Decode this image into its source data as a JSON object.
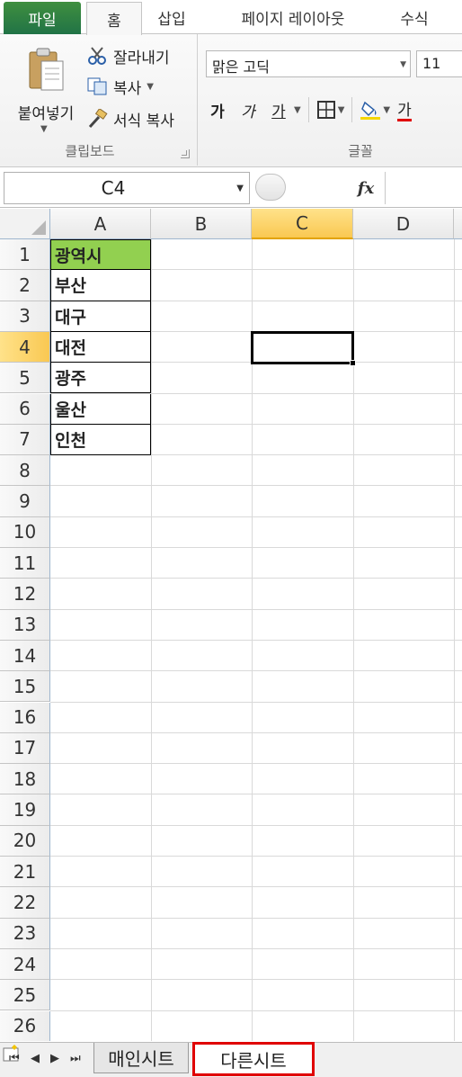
{
  "ribbon": {
    "tabs": [
      {
        "label": "파일"
      },
      {
        "label": "홈"
      },
      {
        "label": "삽입"
      },
      {
        "label": "페이지 레이아웃"
      },
      {
        "label": "수식"
      }
    ],
    "clipboard": {
      "paste_label": "붙여넣기",
      "cut_label": "잘라내기",
      "copy_label": "복사",
      "format_painter_label": "서식 복사",
      "group_label": "클립보드"
    },
    "font": {
      "name": "맑은 고딕",
      "size": "11",
      "bold_label": "가",
      "italic_label": "가",
      "underline_label": "가",
      "color_label": "가",
      "group_label": "글꼴"
    }
  },
  "formula_bar": {
    "name_box": "C4",
    "fx_label": "fx",
    "formula": ""
  },
  "grid": {
    "columns": [
      "A",
      "B",
      "C",
      "D"
    ],
    "active_column": "C",
    "active_row": 4,
    "row_numbers": [
      "1",
      "2",
      "3",
      "4",
      "5",
      "6",
      "7",
      "8",
      "9",
      "10",
      "11",
      "12",
      "13",
      "14",
      "15",
      "16",
      "17",
      "18",
      "19",
      "20",
      "21",
      "22",
      "23",
      "24",
      "25",
      "26"
    ],
    "column_a": [
      "광역시",
      "부산",
      "대구",
      "대전",
      "광주",
      "울산",
      "인천"
    ],
    "header_fill": "#92d050",
    "selected_cell": "C4"
  },
  "sheets": {
    "tabs": [
      {
        "label": "매인시트",
        "active": false
      },
      {
        "label": "다른시트",
        "active": true
      }
    ],
    "highlight_color": "#e00000"
  }
}
